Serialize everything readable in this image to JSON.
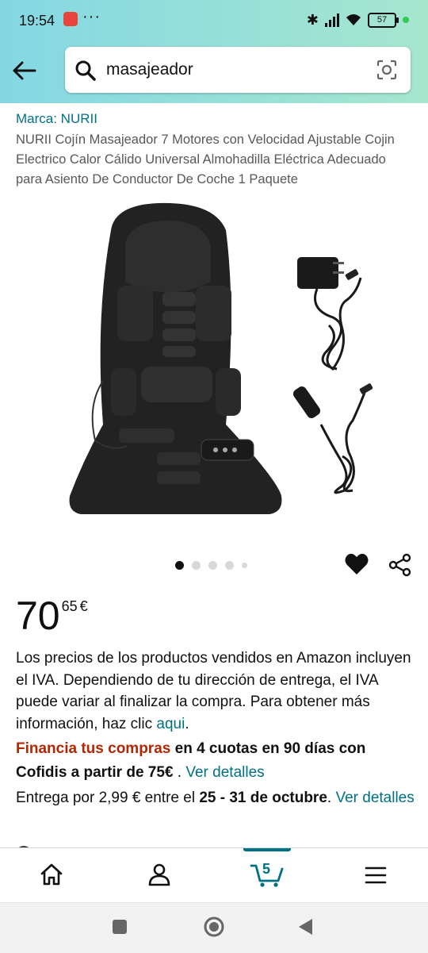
{
  "status_bar": {
    "time": "19:54",
    "more": "···",
    "battery": "57"
  },
  "search": {
    "query": "masajeador"
  },
  "product": {
    "brand": "Marca: NURII",
    "title": "NURII Cojín Masajeador 7 Motores con Velocidad Ajustable Cojin Electrico Calor Cálido Universal Almohadilla Eléctrica Adecuado para Asiento De Conductor De Coche 1 Paquete",
    "image_count": 5,
    "active_image": 1,
    "price_whole": "70",
    "price_fraction": "65",
    "currency": "€"
  },
  "vat_notice": {
    "text": "Los precios de los productos vendidos en Amazon incluyen el IVA. Dependiendo de tu dirección de entrega, el IVA puede variar al finalizar la compra. Para obtener más información, haz clic ",
    "link": "aqui",
    "end": "."
  },
  "financing": {
    "highlight": "Financia tus compras",
    "text": " en 4 cuotas en 90 días con Cofidis a partir de 75€",
    "sep": " . ",
    "link": "Ver detalles"
  },
  "delivery": {
    "prefix": "Entrega por 2,99 € entre el ",
    "dates": "25 - 31 de octubre",
    "suffix": ". ",
    "link": "Ver detalles"
  },
  "bottom_nav": {
    "items": [
      "home-icon",
      "account-icon",
      "cart-icon",
      "menu-icon"
    ],
    "cart_count": "5",
    "accent": "#007185"
  },
  "colors": {
    "link": "#007185",
    "financing_red": "#b12704",
    "header_gradient_start": "#84d8e3",
    "header_gradient_end": "#a6e6ce"
  }
}
